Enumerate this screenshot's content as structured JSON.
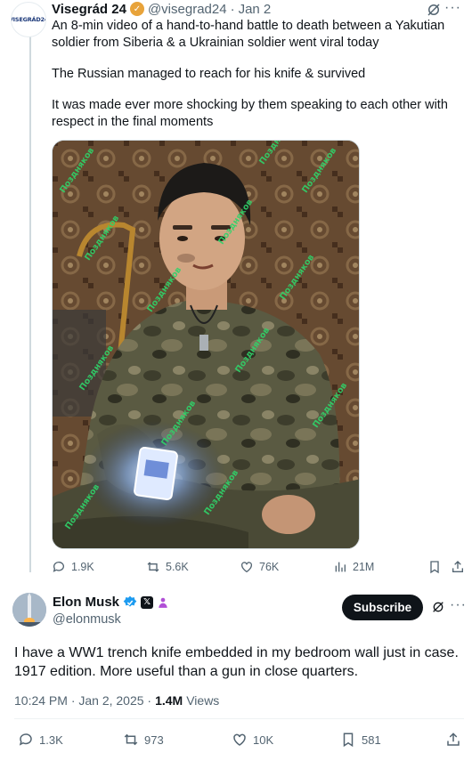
{
  "parent": {
    "avatar_text": "VISEGRÁD24",
    "name": "Visegrád 24",
    "handle": "@visegrad24",
    "separator": "·",
    "date": "Jan 2",
    "paragraphs": [
      "An 8-min video of a hand-to-hand battle to death between a Yakutian soldier from Siberia & a Ukrainian soldier went viral today",
      "The Russian managed to reach for his knife & survived",
      "It was made ever more shocking by them speaking to each other with respect in the final moments"
    ],
    "watermark": "Поздняков",
    "stats": {
      "replies": "1.9K",
      "reposts": "5.6K",
      "likes": "76K",
      "views": "21M"
    },
    "colors": {
      "badge": "#e8a33a",
      "watermark": "#2fd46a"
    }
  },
  "main": {
    "name": "Elon Musk",
    "handle": "@elonmusk",
    "badge_x": "𝕏",
    "subscribe_label": "Subscribe",
    "text": "I have a WW1 trench knife embedded in my bedroom wall just in case. 1917 edition. More useful than a gun in close quarters.",
    "time": "10:24 PM · Jan 2, 2025 ·",
    "views_count": "1.4M",
    "views_label": "Views",
    "stats": {
      "replies": "1.3K",
      "reposts": "973",
      "likes": "10K",
      "bookmarks": "581"
    },
    "colors": {
      "verified": "#1d9bf0",
      "subscribe_bg": "#0f1419",
      "gov_badge": "#b04fd6"
    }
  }
}
